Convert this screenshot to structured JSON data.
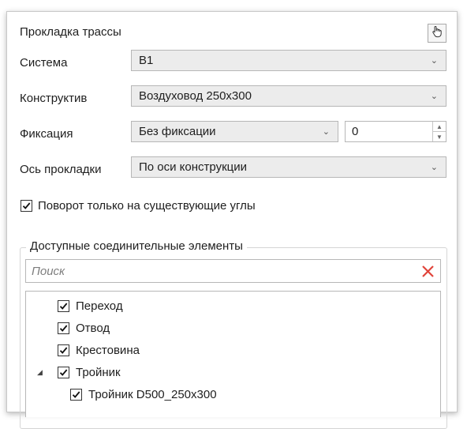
{
  "panel": {
    "title": "Прокладка трассы",
    "pick_button_icon": "hand-pointer-icon"
  },
  "rows": [
    {
      "label": "Система",
      "value": "В1"
    },
    {
      "label": "Конструктив",
      "value": "Воздуховод 250x300"
    },
    {
      "label": "Фиксация",
      "value": "Без фиксации",
      "number": "0"
    },
    {
      "label": "Ось прокладки",
      "value": "По оси конструкции"
    }
  ],
  "rotation_checkbox": {
    "label": "Поворот только на существующие углы",
    "checked": true
  },
  "connectors": {
    "group_title": "Доступные соединительные элементы",
    "search_placeholder": "Поиск",
    "items": [
      {
        "label": "Переход",
        "checked": true
      },
      {
        "label": "Отвод",
        "checked": true
      },
      {
        "label": "Крестовина",
        "checked": true
      },
      {
        "label": "Тройник",
        "checked": true,
        "expanded": true
      },
      {
        "label": "Тройник D500_250x300",
        "checked": true
      }
    ]
  },
  "colors": {
    "combo_bg": "#ececec",
    "border": "#b7b7b7",
    "clear_icon": "#e0443a"
  }
}
